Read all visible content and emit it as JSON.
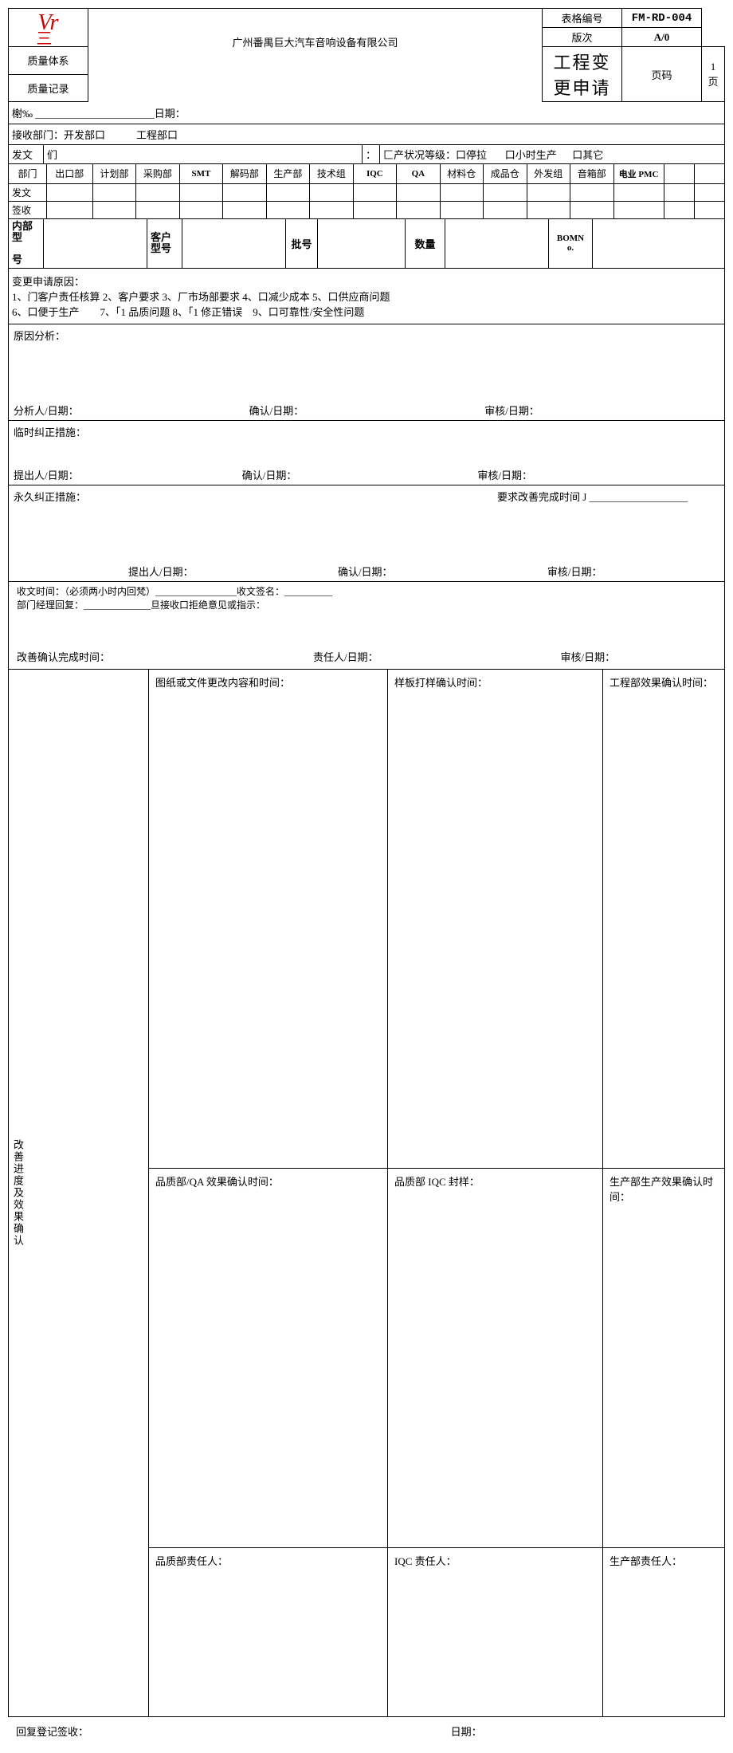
{
  "header": {
    "logo_script": "Vr",
    "logo_under": "三",
    "quality_system": "质量体系",
    "quality_record": "质量记录",
    "company": "广州番禺巨大汽车音响设备有限公司",
    "title": "工程变更申请",
    "form_no_label": "表格编号",
    "form_no": "FM-RD-004",
    "rev_label": "版次",
    "rev": "A/0",
    "page_label": "页码",
    "page": "1 页"
  },
  "row_no_date": "榭‰ _______________________日期：",
  "recv_dept": "接收部门：开发部口　　　工程部口",
  "dispatch": {
    "label_left": "发文　们",
    "colon": "：",
    "prod_status_label": "匚产状况等级：口停拉",
    "small_prod": "口小时生产",
    "other": "口其它"
  },
  "dept_row": {
    "label": "部门",
    "cols": [
      "出口部",
      "计划部",
      "采购部",
      "SMT",
      "解码部",
      "生产部",
      "技术组",
      "IQC",
      "QA",
      "材料仓",
      "成品仓",
      "外发组",
      "音箱部",
      "电业 PMC",
      "",
      ""
    ]
  },
  "dispatch2": "发文",
  "signoff": "签收",
  "model_row": {
    "internal_model": "内部型号",
    "customer_model": "客户型号",
    "batch": "批号",
    "qty": "数量",
    "bom": "BOMNo."
  },
  "change_reason": {
    "heading": "变更申请原因：",
    "line1": "1、门客户责任核算 2、客户要求 3、厂市场部要求 4、口减少成本 5、口供应商问题",
    "line2": "6、口便于生产　　7、「1 品质问题 8、「1 修正错误　9、口可靠性/安全性问题"
  },
  "cause_analysis": {
    "heading": "原因分析：",
    "analyzer": "分析人/日期：",
    "confirm": "确认/日期：",
    "review": "审核/日期："
  },
  "temp_action": {
    "heading": "临时纠正措施：",
    "proposer": "提出人/日期：",
    "confirm": "确认/日期：",
    "review": "审核/日期："
  },
  "perm_action": {
    "heading": "永久纠正措施：",
    "due": "要求改善完成时间 J ___________________",
    "proposer": "提出人/日期：",
    "confirm": "确认/日期：",
    "review": "审核/日期："
  },
  "receipt": {
    "line1": "收文时间：（必须两小时内回梵）_________________收文签名：__________",
    "line2": "部门经理回复：______________旦接收口拒绝意见或指示：",
    "improve_confirm": "改善确认完成时间：",
    "responsible": "责任人/日期：",
    "review": "审核/日期："
  },
  "progress": {
    "vlabel": "改善进度及效果确认",
    "c1": "图纸或文件更改内容和时间：",
    "c2": "样板打样确认时间：",
    "c3": "工程部效果确认时间：",
    "c4": "品质部/QA 效果确认时间：",
    "c5": "品质部 IQC 封样：",
    "c6": "生产部生产效果确认时间：",
    "c7": "品质部责任人：",
    "c8": "IQC 责任人：",
    "c9": "生产部责任人："
  },
  "footer": {
    "reply_sign": "回复登记签收：",
    "date": "日期："
  }
}
